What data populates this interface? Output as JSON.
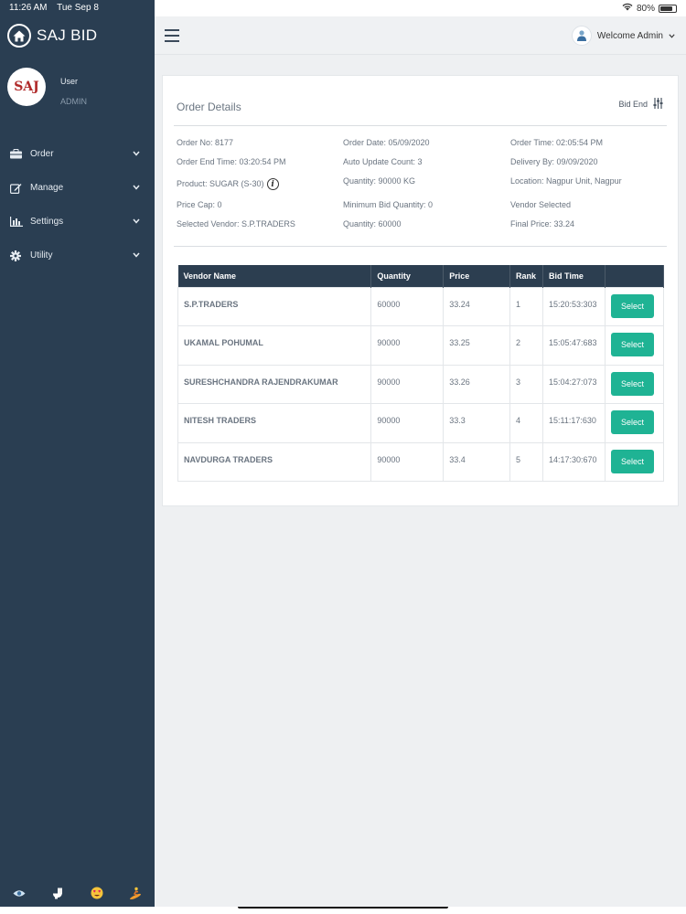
{
  "status_bar": {
    "time": "11:26 AM",
    "date": "Tue Sep 8",
    "battery": "80%",
    "battery_level": 0.8
  },
  "app": {
    "title": "SAJ BID"
  },
  "profile": {
    "avatar_text": "SAJ",
    "name": "User",
    "role": "ADMIN"
  },
  "menu": [
    {
      "label": "Order",
      "icon": "briefcase-icon"
    },
    {
      "label": "Manage",
      "icon": "edit-icon"
    },
    {
      "label": "Settings",
      "icon": "bar-chart-icon"
    },
    {
      "label": "Utility",
      "icon": "gear-icon"
    }
  ],
  "header": {
    "welcome": "Welcome Admin"
  },
  "order": {
    "title": "Order Details",
    "bid_end_label": "Bid End",
    "details": [
      [
        "Order No: 8177",
        "Order Date: 05/09/2020",
        "Order Time: 02:05:54 PM"
      ],
      [
        "Order End Time: 03:20:54 PM",
        "Auto Update Count: 3",
        "Delivery By: 09/09/2020"
      ],
      [
        "Product: SUGAR (S-30)",
        "Quantity: 90000 KG",
        "Location: Nagpur Unit, Nagpur"
      ],
      [
        "Price Cap: 0",
        "Minimum Bid Quantity: 0",
        "Vendor Selected"
      ],
      [
        "Selected Vendor: S.P.TRADERS",
        "Quantity: 60000",
        "Final Price: 33.24"
      ]
    ]
  },
  "table": {
    "headers": [
      "Vendor Name",
      "Quantity",
      "Price",
      "Rank",
      "Bid Time",
      ""
    ],
    "select_label": "Select",
    "rows": [
      {
        "vendor": "S.P.TRADERS",
        "quantity": "60000",
        "price": "33.24",
        "rank": "1",
        "bid_time": "15:20:53:303"
      },
      {
        "vendor": "UKAMAL POHUMAL",
        "quantity": "90000",
        "price": "33.25",
        "rank": "2",
        "bid_time": "15:05:47:683"
      },
      {
        "vendor": "SURESHCHANDRA RAJENDRAKUMAR",
        "quantity": "90000",
        "price": "33.26",
        "rank": "3",
        "bid_time": "15:04:27:073"
      },
      {
        "vendor": "NITESH TRADERS",
        "quantity": "90000",
        "price": "33.3",
        "rank": "4",
        "bid_time": "15:11:17:630"
      },
      {
        "vendor": "NAVDURGA TRADERS",
        "quantity": "90000",
        "price": "33.4",
        "rank": "5",
        "bid_time": "14:17:30:670"
      }
    ]
  },
  "bottom_icons": [
    "eye-icon",
    "toilet-icon",
    "heart-eyes-emoji-icon",
    "surfer-icon"
  ],
  "colors": {
    "sidebar": "#2a3e52",
    "table_header": "#2c3e50",
    "accent": "#1fb394"
  }
}
